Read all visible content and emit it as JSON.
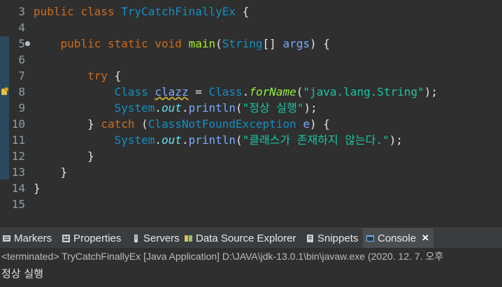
{
  "editor": {
    "lines": [
      {
        "n": "3"
      },
      {
        "n": "4"
      },
      {
        "n": "5"
      },
      {
        "n": "6"
      },
      {
        "n": "7"
      },
      {
        "n": "8"
      },
      {
        "n": "9"
      },
      {
        "n": "10"
      },
      {
        "n": "11"
      },
      {
        "n": "12"
      },
      {
        "n": "13"
      },
      {
        "n": "14"
      },
      {
        "n": "15"
      }
    ],
    "tokens": {
      "public": "public",
      "class": "class",
      "class_name": "TryCatchFinallyEx",
      "brace_open": "{",
      "brace_close": "}",
      "static": "static",
      "void": "void",
      "main": "main",
      "paren_open": "(",
      "string_type": "String",
      "array_brackets": "[]",
      "args": "args",
      "paren_close_brace": ") {",
      "try": "try",
      "Class": "Class",
      "clazz": "clazz",
      "equals": "=",
      "forName": "forName",
      "dot": ".",
      "str_java_lang": "\"java.lang.String\"",
      "close_paren_semi": ");",
      "System": "System",
      "out": "out",
      "println": "println",
      "str_normal": "\"정상 실행\"",
      "catch": "catch",
      "exception": "ClassNotFoundException",
      "e": "e",
      "str_class_missing": "\"클래스가 존재하지 않는다.\""
    }
  },
  "panel": {
    "tabs": [
      {
        "label": "Markers"
      },
      {
        "label": "Properties"
      },
      {
        "label": "Servers"
      },
      {
        "label": "Data Source Explorer"
      },
      {
        "label": "Snippets"
      },
      {
        "label": "Console"
      }
    ],
    "status": "<terminated> TryCatchFinallyEx [Java Application] D:\\JAVA\\jdk-13.0.1\\bin\\javaw.exe (2020. 12. 7. 오후",
    "output": "정상 실행"
  },
  "colors": {
    "background": "#2f2f2f",
    "keyword": "#cc6c1d",
    "class": "#1290c3",
    "method": "#a7ec21",
    "string": "#17c6a3"
  }
}
